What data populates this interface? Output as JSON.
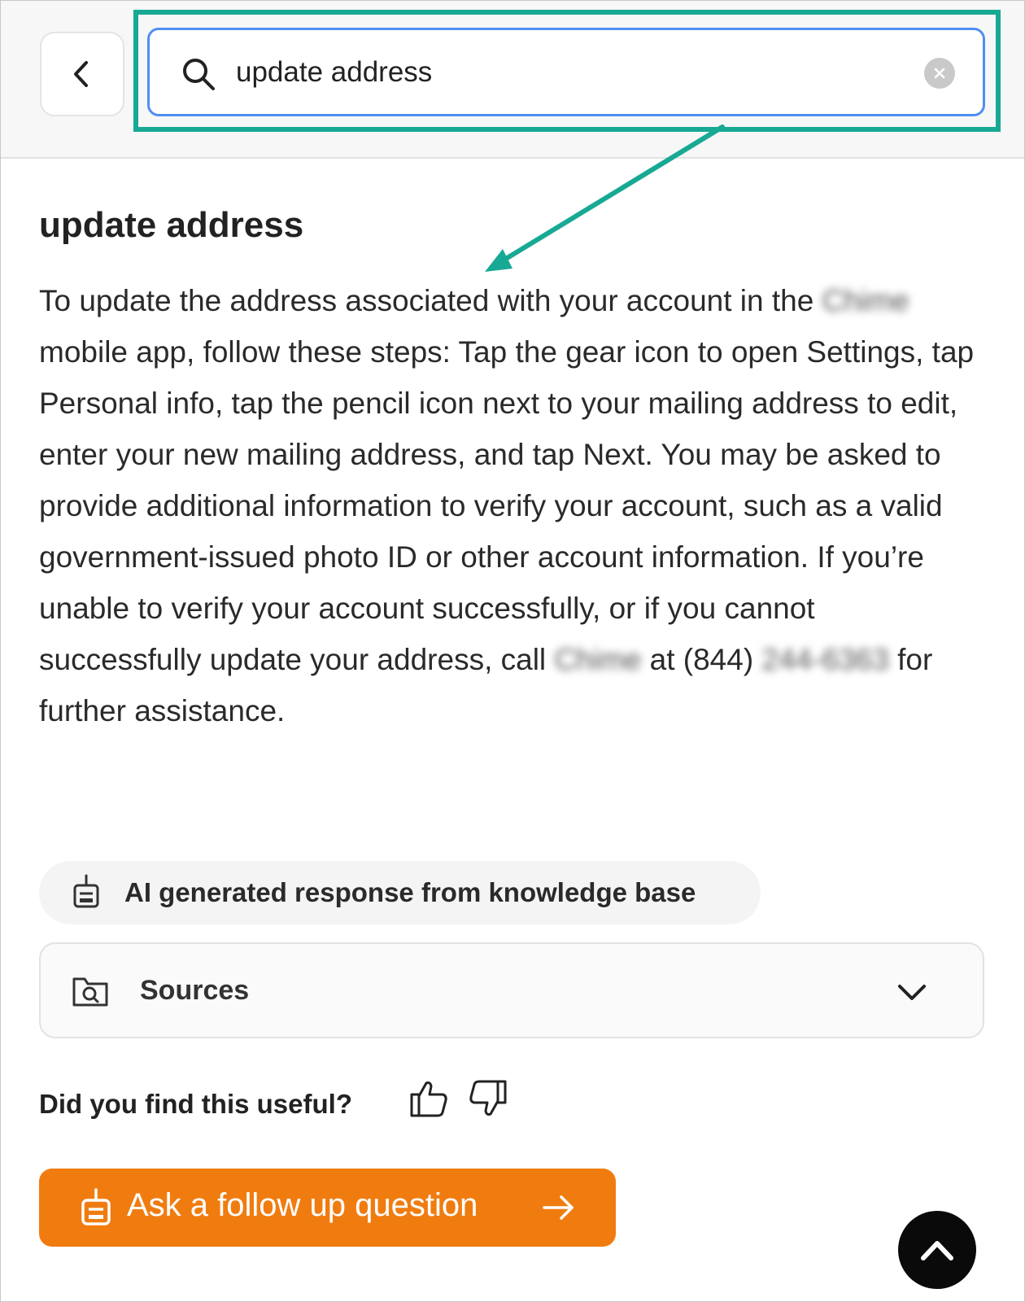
{
  "search": {
    "value": "update address"
  },
  "answer": {
    "title": "update address",
    "segments": {
      "p1": "To update the address associated with your account in the ",
      "redacted_brand_1": "Chime",
      "p2": " mobile app, follow these steps: Tap the gear icon to open Settings, tap Personal info, tap the pencil icon next to your mailing address to edit, enter your new mailing address, and tap Next. You may be asked to provide additional information to verify your account, such as a valid government-issued photo ID or other account information. If you’re unable to verify your account successfully, or if you cannot successfully update your address, call ",
      "redacted_brand_2": "Chime",
      "p3": " at (844) ",
      "redacted_phone": "244-6363",
      "p4": " for further assistance."
    }
  },
  "ai_chip": {
    "label": "AI generated response from knowledge base",
    "icon": "robot-icon"
  },
  "sources": {
    "label": "Sources",
    "icon": "folder-search-icon",
    "expand_icon": "chevron-down-icon"
  },
  "feedback": {
    "question": "Did you find this useful?",
    "up_icon": "thumbs-up-icon",
    "down_icon": "thumbs-down-icon"
  },
  "ask_button": {
    "label": "Ask a follow up question",
    "icon": "robot-icon",
    "arrow_icon": "arrow-right-icon"
  },
  "colors": {
    "accent_orange": "#f07c10",
    "highlight_teal": "#17a994",
    "focus_blue": "#4f8ff0"
  }
}
